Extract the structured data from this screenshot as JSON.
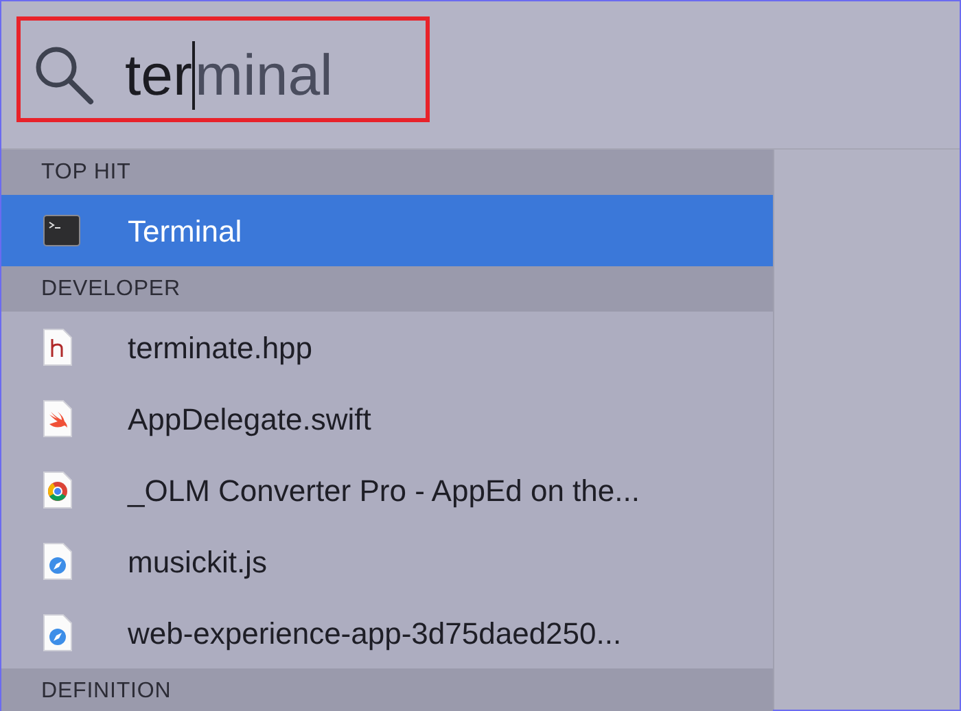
{
  "search": {
    "typed": "ter",
    "completion": "minal",
    "highlighted": true
  },
  "sections": [
    {
      "title": "TOP HIT",
      "items": [
        {
          "label": "Terminal",
          "kind": "terminal",
          "selected": true
        }
      ]
    },
    {
      "title": "DEVELOPER",
      "items": [
        {
          "label": "terminate.hpp",
          "kind": "header",
          "selected": false
        },
        {
          "label": "AppDelegate.swift",
          "kind": "swift",
          "selected": false
        },
        {
          "label": "_OLM Converter Pro - AppEd on the...",
          "kind": "chrome",
          "selected": false
        },
        {
          "label": "musickit.js",
          "kind": "safari",
          "selected": false
        },
        {
          "label": "web-experience-app-3d75daed250...",
          "kind": "safari",
          "selected": false
        }
      ]
    },
    {
      "title": "DEFINITION"
    }
  ]
}
